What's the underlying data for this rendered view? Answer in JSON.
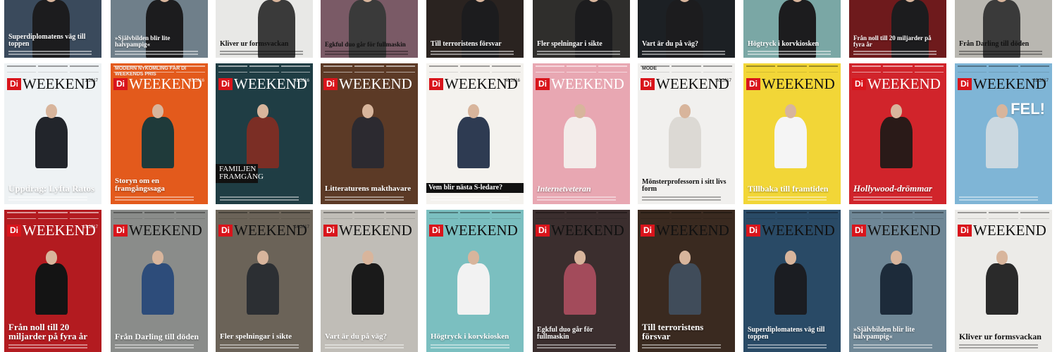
{
  "masthead": {
    "brand": "Di",
    "title": "WEEKEND"
  },
  "row_top": [
    {
      "headline": "Superdiplomatens väg till toppen",
      "bg": "#3a4a5c",
      "size": 10
    },
    {
      "headline": "»Självbilden blir lite halvpampig«",
      "bg": "#6f7f8a",
      "size": 9
    },
    {
      "headline": "Kliver ur formsvackan",
      "bg": "#e8e8e6",
      "size": 10,
      "dark": true
    },
    {
      "headline": "Egkful duo går för fullmaskin",
      "bg": "#7a5a66",
      "size": 9,
      "dark": true
    },
    {
      "headline": "Till terroristens försvar",
      "bg": "#2a2320",
      "size": 10
    },
    {
      "headline": "Fler spelningar i sikte",
      "bg": "#2f2e2c",
      "size": 10
    },
    {
      "headline": "Vart är du på väg?",
      "bg": "#1c2024",
      "size": 10
    },
    {
      "headline": "Högtryck i korvkiosken",
      "bg": "#7aa7a5",
      "size": 10
    },
    {
      "headline": "Från noll till 20 miljarder på fyra år",
      "bg": "#6e1a1c",
      "size": 9
    },
    {
      "headline": "Från Darling till döden",
      "bg": "#b9b7b1",
      "size": 10,
      "dark": true
    }
  ],
  "row_mid": [
    {
      "headline": "Uppdrag: Lyfta Ratos",
      "issue": "1 2017",
      "bg": "#eef2f4",
      "fig": "#22252b",
      "size": 13
    },
    {
      "headline": "Storyn om en framgångssaga",
      "issue": "47 2016",
      "bg": "#e35a1c",
      "fig": "#1f3a3a",
      "size": 11,
      "light": true,
      "top_text": "MODERN NYKOMLING FÅR DI WEEKENDS PRIS"
    },
    {
      "headline": "FAMILJEN FRAMGÅNG",
      "issue": "41 2016",
      "bg": "#1f3d44",
      "fig": "#7b2e25",
      "size": 10,
      "light": true
    },
    {
      "headline": "Litteraturens makthavare",
      "issue": "",
      "bg": "#5c3a26",
      "fig": "#2c2a30",
      "size": 11,
      "light": true
    },
    {
      "headline": "Vem blir nästa S-ledare?",
      "issue": "46 2016",
      "bg": "#f4f2ee",
      "fig": "#2e3b52",
      "size": 10
    },
    {
      "headline": "Internetveteran",
      "issue": "",
      "bg": "#e8a7b2",
      "fig": "#f3ecea",
      "size": 12,
      "light": true
    },
    {
      "headline": "Mönsterprofessorn i sitt livs form",
      "issue": "30 2017",
      "bg": "#f1f0ee",
      "fig": "#dcd9d4",
      "size": 10,
      "dark": true,
      "top_text": "MODE"
    },
    {
      "headline": "Tillbaka till framtiden",
      "issue": "",
      "bg": "#f2d637",
      "fig": "#f5f5f5",
      "size": 12
    },
    {
      "headline": "Hollywood-drömmar",
      "issue": "",
      "bg": "#d1242b",
      "fig": "#2a1a18",
      "size": 13,
      "light": true
    },
    {
      "headline": "FEL!",
      "issue": "29 2017",
      "bg": "#7fb5d6",
      "fig": "#cbd8e0",
      "size": 22
    }
  ],
  "row_bot": [
    {
      "headline": "Från noll till 20 miljarder på fyra år",
      "issue": "17 2017",
      "bg": "#b31b20",
      "fig": "#141414",
      "size": 13,
      "light": true
    },
    {
      "headline": "Från Darling till döden",
      "issue": "",
      "bg": "#8a8c8a",
      "fig": "#2d4c7a",
      "size": 12
    },
    {
      "headline": "Fler spelningar i sikte",
      "issue": "14 2017",
      "bg": "#6b6358",
      "fig": "#2c2f33",
      "size": 11
    },
    {
      "headline": "Vart är du på väg?",
      "issue": "",
      "bg": "#c0bdb7",
      "fig": "#1a1a1a",
      "size": 11
    },
    {
      "headline": "Högtryck i korvkiosken",
      "issue": "",
      "bg": "#7bbfc0",
      "fig": "#f2f2f2",
      "size": 11
    },
    {
      "headline": "Egkful duo går för fullmaskin",
      "issue": "",
      "bg": "#3b2e2e",
      "fig": "#a34b5b",
      "size": 10
    },
    {
      "headline": "Till terroristens försvar",
      "issue": "",
      "bg": "#3a2a20",
      "fig": "#404c5a",
      "size": 13
    },
    {
      "headline": "Superdiplomatens väg till toppen",
      "issue": "",
      "bg": "#294a66",
      "fig": "#1b1d22",
      "size": 10
    },
    {
      "headline": "»Självbilden blir lite halvpampig«",
      "issue": "",
      "bg": "#6f8796",
      "fig": "#1d2b3a",
      "size": 10
    },
    {
      "headline": "Kliver ur formsvackan",
      "issue": "",
      "bg": "#ecebe8",
      "fig": "#2a2a2a",
      "size": 12,
      "dark": true
    }
  ]
}
